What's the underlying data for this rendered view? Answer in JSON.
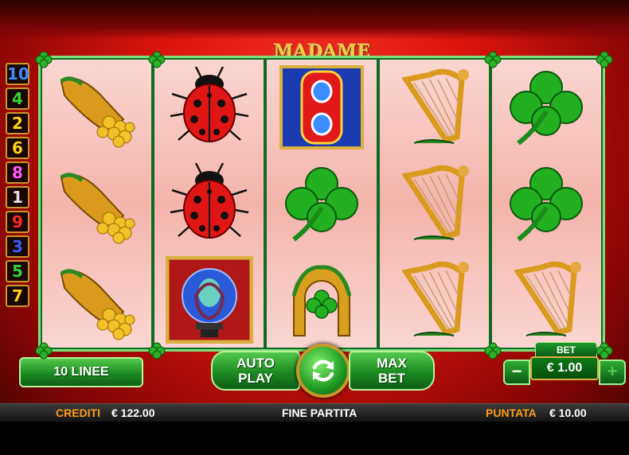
{
  "game": {
    "title": "MADAME FORTUNA"
  },
  "line_numbers": [
    {
      "label": "10",
      "color": "#3a8cff"
    },
    {
      "label": "4",
      "color": "#33d43a"
    },
    {
      "label": "2",
      "color": "#ffd21a"
    },
    {
      "label": "6",
      "color": "#ffd21a"
    },
    {
      "label": "8",
      "color": "#ff5aff"
    },
    {
      "label": "1",
      "color": "#e0e0e0"
    },
    {
      "label": "9",
      "color": "#ff2a2a"
    },
    {
      "label": "3",
      "color": "#3a5cff"
    },
    {
      "label": "5",
      "color": "#33d43a"
    },
    {
      "label": "7",
      "color": "#ffd21a"
    }
  ],
  "reels": [
    [
      "cornucopia",
      "cornucopia",
      "cornucopia"
    ],
    [
      "ladybug",
      "ladybug",
      "fortune-teller"
    ],
    [
      "eight",
      "clover",
      "horseshoe"
    ],
    [
      "harp",
      "harp",
      "harp"
    ],
    [
      "clover",
      "clover",
      "harp"
    ]
  ],
  "controls": {
    "lines_label": "10 LINEE",
    "auto_play_line1": "AUTO",
    "auto_play_line2": "PLAY",
    "max_bet_line1": "MAX",
    "max_bet_line2": "BET",
    "bet_label": "BET",
    "bet_value": "€ 1.00",
    "minus_label": "−",
    "plus_label": "+"
  },
  "status": {
    "credits_label": "CREDITI",
    "credits_value": "€ 122.00",
    "message": "FINE PARTITA",
    "stake_label": "PUNTATA",
    "stake_value": "€ 10.00"
  },
  "colors": {
    "accent_gold": "#c9962a",
    "button_green": "#1d8a22",
    "status_label": "#ff9a1a"
  }
}
